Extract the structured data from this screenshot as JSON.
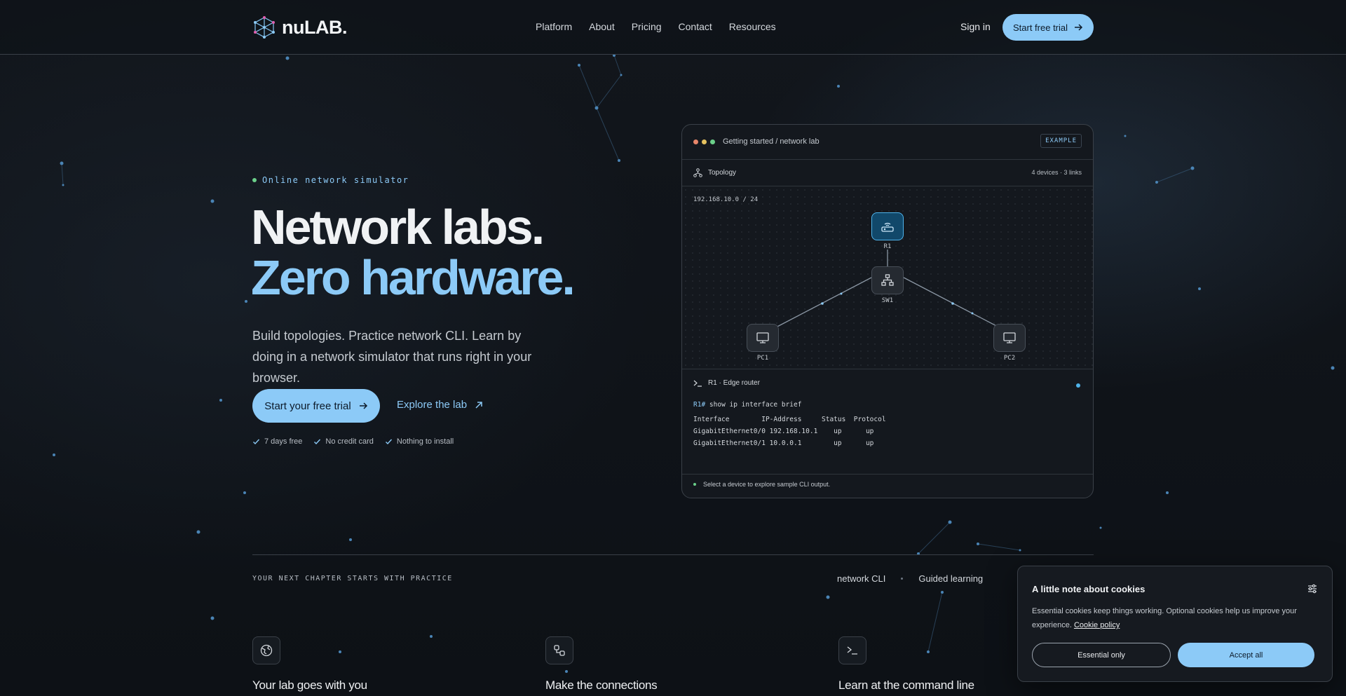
{
  "header": {
    "brand": "nuLAB.",
    "nav": [
      "Platform",
      "About",
      "Pricing",
      "Contact",
      "Resources"
    ],
    "sign_in": "Sign in",
    "trial_cta": "Start free trial"
  },
  "hero": {
    "eyebrow": "Online network simulator",
    "title_line1": "Network labs.",
    "title_line2": "Zero hardware.",
    "lead": "Build topologies. Practice network CLI. Learn by doing in a network simulator that runs right in your browser.",
    "primary_cta": "Start your free trial",
    "secondary_cta": "Explore the lab",
    "checks": [
      "7 days free",
      "No credit card",
      "Nothing to install"
    ]
  },
  "lab_card": {
    "breadcrumb": "Getting started / network lab",
    "badge": "EXAMPLE",
    "topology_title": "Topology",
    "topology_count": "4 devices · 3 links",
    "subnet": "192.168.10.0 / 24",
    "devices": {
      "r1": "R1",
      "sw1": "SW1",
      "pc1": "PC1",
      "pc2": "PC2"
    },
    "terminal_title": "R1 · Edge router",
    "prompt": "R1#",
    "command": "show ip interface brief",
    "table_header": "Interface        IP-Address     Status  Protocol",
    "rows": [
      "GigabitEthernet0/0 192.168.10.1    up      up",
      "GigabitEthernet0/1 10.0.0.1        up      up"
    ],
    "footer": "Select a device to explore sample CLI output."
  },
  "section": {
    "chapter": "YOUR NEXT CHAPTER STARTS WITH PRACTICE",
    "tags": [
      "network CLI",
      "Guided learning"
    ],
    "features": [
      "Your lab goes with you",
      "Make the connections",
      "Learn at the command line"
    ]
  },
  "cookie": {
    "title": "A little note about cookies",
    "body": "Essential cookies keep things working. Optional cookies help us improve your experience.",
    "policy_link": "Cookie policy",
    "essential": "Essential only",
    "accept": "Accept all"
  },
  "colors": {
    "accent": "#8ccaf7",
    "background": "#0e1217",
    "status": "#6bd08a"
  }
}
